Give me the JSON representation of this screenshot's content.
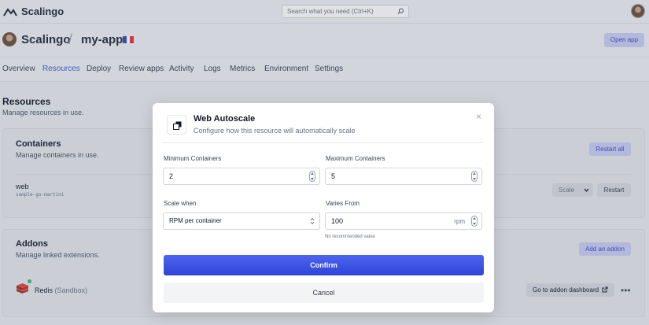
{
  "topbar": {
    "brand": "Scalingo",
    "search_placeholder": "Search what you need (Ctrl+K)"
  },
  "app_header": {
    "org": "Scalingo",
    "separator": "/",
    "app": "my-app",
    "flag_colors": [
      "#2b4fb0",
      "#ffffff",
      "#e2323c"
    ],
    "open_app_label": "Open app"
  },
  "tabs": [
    {
      "label": "Overview",
      "active": false
    },
    {
      "label": "Resources",
      "active": true
    },
    {
      "label": "Deploy",
      "active": false
    },
    {
      "label": "Review apps",
      "active": false
    },
    {
      "label": "Activity",
      "active": false
    },
    {
      "label": "Logs",
      "active": false
    },
    {
      "label": "Metrics",
      "active": false
    },
    {
      "label": "Environment",
      "active": false
    },
    {
      "label": "Settings",
      "active": false
    }
  ],
  "resources": {
    "title": "Resources",
    "subtitle": "Manage resources in use."
  },
  "containers": {
    "title": "Containers",
    "subtitle": "Manage containers in use.",
    "restart_all_label": "Restart all",
    "row": {
      "name": "web",
      "sub": "sample-go-martini",
      "scale_label": "Scale",
      "restart_label": "Restart"
    }
  },
  "addons": {
    "title": "Addons",
    "subtitle": "Manage linked extensions.",
    "add_label": "Add an addon",
    "row": {
      "name": "Redis",
      "plan": "(Sandbox)",
      "dashboard_label": "Go to addon dashboard",
      "more": "•••"
    }
  },
  "modal": {
    "title": "Web Autoscale",
    "subtitle": "Configure how this resource will automatically scale",
    "close": "×",
    "min_label": "Minimum Containers",
    "min_value": "2",
    "max_label": "Maximum Containers",
    "max_value": "5",
    "scale_when_label": "Scale when",
    "scale_when_value": "RPM per container",
    "varies_from_label": "Varies From",
    "varies_from_value": "100",
    "varies_from_unit": "rpm",
    "hint": "No recommended value",
    "confirm_label": "Confirm",
    "cancel_label": "Cancel"
  },
  "colors": {
    "accent": "#3b5bdb",
    "confirm_start": "#4d63f0",
    "confirm_end": "#2f45d8",
    "addon_status": "#22c55e",
    "redis_red": "#c0302a"
  }
}
